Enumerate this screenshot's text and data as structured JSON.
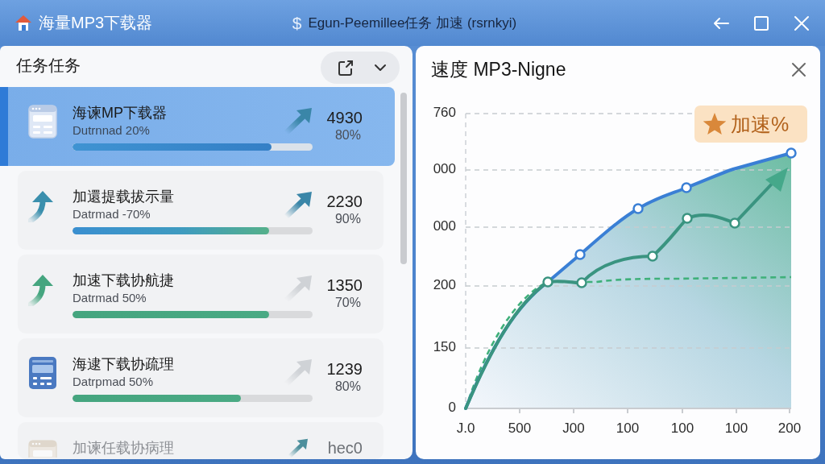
{
  "title_bar": {
    "title": "海量MP3下载器",
    "center_glyph": "$",
    "center_text": "Egun-Peemillee任务 加速 (rsrnkyi)"
  },
  "task_panel": {
    "title": "任务任务",
    "tasks": [
      {
        "name": "海谏MP下载器",
        "status": "Dutrnnad 20%",
        "level": 0.83,
        "count": "4930",
        "percent": "80%",
        "selected": true,
        "disabled": false
      },
      {
        "name": "加還提载拔示量",
        "status": "Datrmad -70%",
        "level": 0.82,
        "count": "2230",
        "percent": "90%",
        "selected": false,
        "disabled": false
      },
      {
        "name": "加速下载协航捷",
        "status": "Datrmad 50%",
        "level": 0.82,
        "count": "1350",
        "percent": "70%",
        "selected": false,
        "disabled": false
      },
      {
        "name": "海逮下载协疏理",
        "status": "Datrpmad 50%",
        "level": 0.7,
        "count": "1239",
        "percent": "80%",
        "selected": false,
        "disabled": false
      },
      {
        "name": "加谏任载协病理",
        "count": "hec0",
        "selected": false,
        "disabled": true
      }
    ]
  },
  "chart_panel": {
    "title": "速度 MP3-Nigne",
    "y_axis_labels": [
      "760",
      "000",
      "000",
      "200",
      "150",
      "0"
    ],
    "x_axis_labels": [
      "J.0",
      "500",
      "J00",
      "100",
      "100",
      "100",
      "200"
    ],
    "badge": "加速%"
  }
}
